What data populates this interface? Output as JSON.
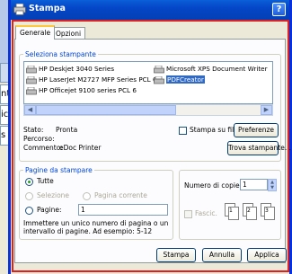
{
  "background": {
    "tabs": [
      "",
      "nt",
      "ic",
      "s"
    ]
  },
  "dialog": {
    "title": "Stampa",
    "help": "?",
    "tabs": {
      "generale": "Generale",
      "opzioni": "Opzioni"
    }
  },
  "printer_group": {
    "legend": "Seleziona stampante",
    "printers": [
      {
        "label": "HP Deskjet 3040 Series",
        "selected": false
      },
      {
        "label": "Microsoft XPS Document Writer",
        "selected": false
      },
      {
        "label": "HP LaserJet M2727 MFP Series PCL 6",
        "selected": false
      },
      {
        "label": "PDFCreator",
        "selected": true
      },
      {
        "label": "HP Officejet 9100 series PCL 6",
        "selected": false
      }
    ],
    "status_label": "Stato:",
    "status_value": "Pronta",
    "path_label": "Percorso:",
    "path_value": "",
    "comment_label": "Commento:",
    "comment_value": "eDoc Printer",
    "print_to_file": "Stampa su file",
    "preferences": "Preferenze",
    "find_printer": "Trova stampante..."
  },
  "range_group": {
    "legend": "Pagine da stampare",
    "all": "Tutte",
    "selection": "Selezione",
    "current_page": "Pagina corrente",
    "pages": "Pagine:",
    "pages_value": "1",
    "hint_line1": "Immettere un unico numero di pagina o un",
    "hint_line2": "intervallo di pagine. Ad esempio: 5-12"
  },
  "copies_group": {
    "copies_label": "Numero di copie:",
    "copies_value": "1",
    "collate": "Fascic.",
    "pages_icons": [
      "1",
      "1",
      "2",
      "2",
      "3",
      "3"
    ]
  },
  "buttons": {
    "print": "Stampa",
    "cancel": "Annulla",
    "apply": "Applica"
  },
  "colors": {
    "title_bar": "#0446c7",
    "selection": "#316ac5",
    "highlight_outline": "#e02020"
  }
}
